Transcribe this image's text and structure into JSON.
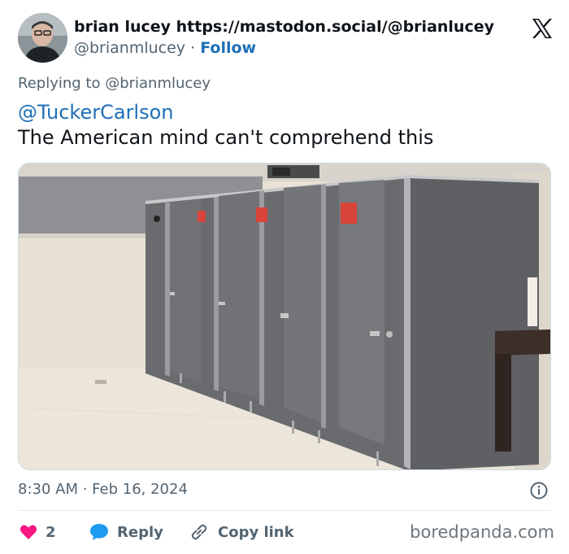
{
  "author": {
    "display_name": "brian lucey https://mastodon.social/@brianlucey",
    "handle": "@brianmlucey",
    "separator": "·",
    "follow_label": "Follow"
  },
  "tweet": {
    "replying_to": "Replying to @brianmlucey",
    "mention": "@TuckerCarlson",
    "text": "The American mind can't comprehend this",
    "timestamp": "8:30 AM · Feb 16, 2024"
  },
  "actions": {
    "like_count": "2",
    "reply_label": "Reply",
    "copy_link_label": "Copy link"
  },
  "watermark": "boredpanda.com",
  "icons": {
    "logo": "x-logo-icon",
    "info": "info-icon",
    "like": "heart-icon",
    "reply": "speech-bubble-icon",
    "copy": "link-icon"
  },
  "colors": {
    "accent": "#1d6fb8",
    "like": "#f91880",
    "muted": "#536471"
  }
}
